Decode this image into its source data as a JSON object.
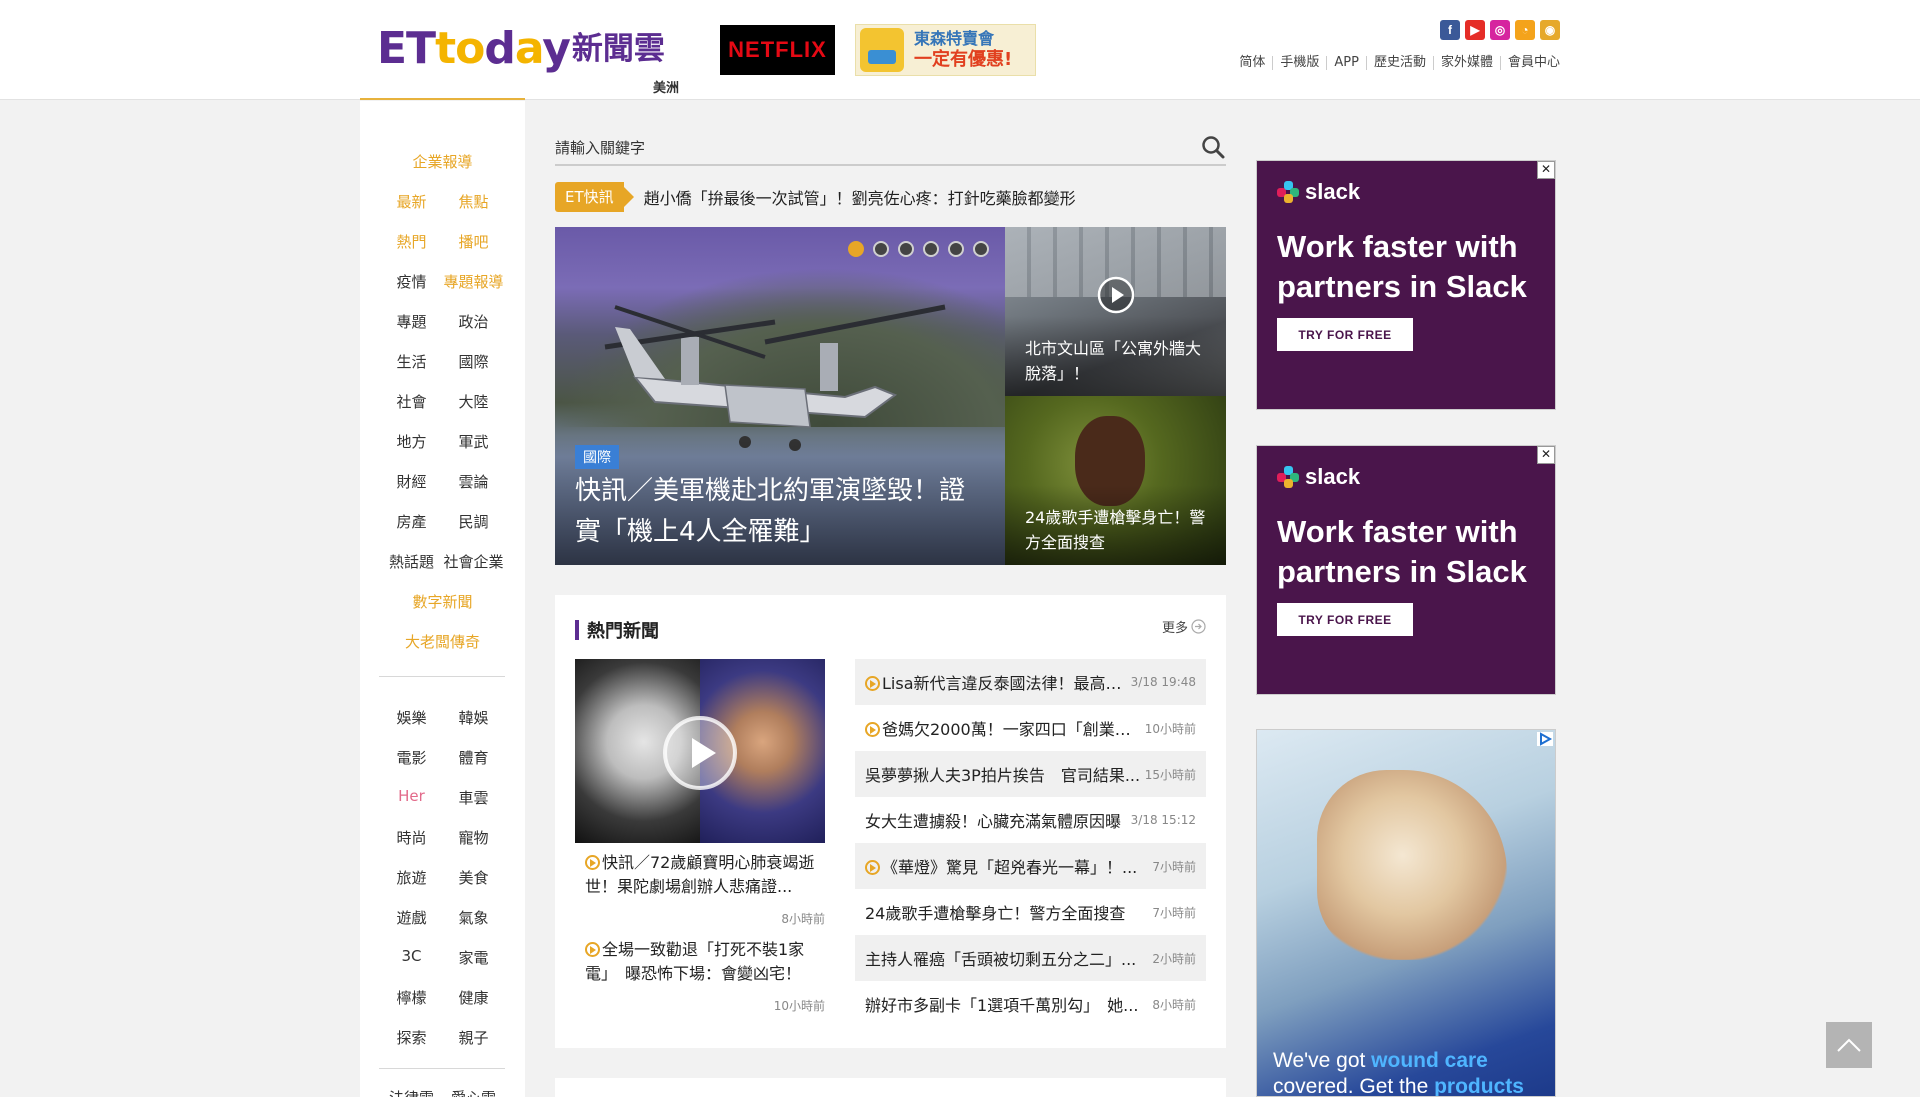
{
  "header": {
    "logo_et": "ETtoday",
    "logo_zh": "新聞雲",
    "region": "美洲",
    "netflix_label": "NETFLIX",
    "promo_line1": "東森特賣會",
    "promo_line2": "一定有優惠!",
    "social": [
      "facebook-icon",
      "youtube-icon",
      "instagram-icon",
      "rss-icon",
      "weibo-icon"
    ],
    "nav": [
      "简体",
      "手機版",
      "APP",
      "歷史活動",
      "家外媒體",
      "會員中心"
    ]
  },
  "sidebar": {
    "rows": [
      {
        "items": [
          {
            "label": "企業報導",
            "color": "gold"
          }
        ]
      },
      {
        "items": [
          {
            "label": "最新",
            "color": "gold"
          },
          {
            "label": "焦點",
            "color": "gold"
          }
        ]
      },
      {
        "items": [
          {
            "label": "熱門",
            "color": "gold"
          },
          {
            "label": "播吧",
            "color": "gold"
          }
        ]
      },
      {
        "items": [
          {
            "label": "疫情",
            "color": "dark"
          },
          {
            "label": "專題報導",
            "color": "gold"
          }
        ]
      },
      {
        "items": [
          {
            "label": "專題",
            "color": "dark"
          },
          {
            "label": "政治",
            "color": "dark"
          }
        ]
      },
      {
        "items": [
          {
            "label": "生活",
            "color": "dark"
          },
          {
            "label": "國際",
            "color": "dark"
          }
        ]
      },
      {
        "items": [
          {
            "label": "社會",
            "color": "dark"
          },
          {
            "label": "大陸",
            "color": "dark"
          }
        ]
      },
      {
        "items": [
          {
            "label": "地方",
            "color": "dark"
          },
          {
            "label": "軍武",
            "color": "dark"
          }
        ]
      },
      {
        "items": [
          {
            "label": "財經",
            "color": "dark"
          },
          {
            "label": "雲論",
            "color": "dark"
          }
        ]
      },
      {
        "items": [
          {
            "label": "房產",
            "color": "dark"
          },
          {
            "label": "民調",
            "color": "dark"
          }
        ]
      },
      {
        "items": [
          {
            "label": "熱話題",
            "color": "dark"
          },
          {
            "label": "社會企業",
            "color": "dark"
          }
        ]
      },
      {
        "items": [
          {
            "label": "數字新聞",
            "color": "gold"
          }
        ]
      },
      {
        "items": [
          {
            "label": "大老闆傳奇",
            "color": "gold"
          }
        ]
      },
      {
        "items": [
          {
            "label": "娛樂",
            "color": "dark"
          },
          {
            "label": "韓娛",
            "color": "dark"
          }
        ]
      },
      {
        "items": [
          {
            "label": "電影",
            "color": "dark"
          },
          {
            "label": "體育",
            "color": "dark"
          }
        ]
      },
      {
        "items": [
          {
            "label": "Her",
            "color": "pink"
          },
          {
            "label": "車雲",
            "color": "dark"
          }
        ]
      },
      {
        "items": [
          {
            "label": "時尚",
            "color": "dark"
          },
          {
            "label": "寵物",
            "color": "dark"
          }
        ]
      },
      {
        "items": [
          {
            "label": "旅遊",
            "color": "dark"
          },
          {
            "label": "美食",
            "color": "dark"
          }
        ]
      },
      {
        "items": [
          {
            "label": "遊戲",
            "color": "dark"
          },
          {
            "label": "氣象",
            "color": "dark"
          }
        ]
      },
      {
        "items": [
          {
            "label": "3C",
            "color": "dark"
          },
          {
            "label": "家電",
            "color": "dark"
          }
        ]
      },
      {
        "items": [
          {
            "label": "檸檬",
            "color": "dark"
          },
          {
            "label": "健康",
            "color": "dark"
          }
        ]
      },
      {
        "items": [
          {
            "label": "探索",
            "color": "dark"
          },
          {
            "label": "親子",
            "color": "dark"
          }
        ]
      },
      {
        "items": [
          {
            "label": "法律雲",
            "color": "dark"
          },
          {
            "label": "愛心雲",
            "color": "dark"
          }
        ]
      }
    ]
  },
  "search": {
    "placeholder": "請輸入關鍵字"
  },
  "flash": {
    "tag": "ET快訊",
    "text": "趙小僑「拚最後一次試管」！劉亮佐心疼：打針吃藥臉都變形"
  },
  "hero": {
    "tag": "國際",
    "title": "快訊／美軍機赴北約軍演墜毀！證實「機上4人全罹難」",
    "dots_total": 6,
    "active_dot": 1
  },
  "side_stories": [
    {
      "title": "北市文山區「公寓外牆大脫落」！",
      "video": true
    },
    {
      "title": "24歲歌手遭槍擊身亡！警方全面搜查",
      "video": false
    }
  ],
  "hot": {
    "title": "熱門新聞",
    "more": "更多",
    "left": [
      {
        "title": "快訊／72歲顧寶明心肺衰竭逝世！果陀劇場創辦人悲痛證...",
        "time": "8小時前"
      },
      {
        "title": "全場一致勸退「打死不裝1家電」　曝恐怖下場：會變凶宅！",
        "time": "10小時前"
      }
    ],
    "list": [
      {
        "title": "Lisa新代言違反泰國法律！最高「...",
        "time": "3/18 19:48",
        "video": true
      },
      {
        "title": "爸媽欠2000萬！一家四口「創業賣...",
        "time": "10小時前",
        "video": true
      },
      {
        "title": "吳夢夢揪人夫3P拍片挨告　官司結果...",
        "time": "15小時前",
        "video": false
      },
      {
        "title": "女大生遭擄殺！心臟充滿氣體原因曝",
        "time": "3/18 15:12",
        "video": false
      },
      {
        "title": "《華燈》驚見「超兇春光一幕」！...",
        "time": "7小時前",
        "video": true
      },
      {
        "title": "24歲歌手遭槍擊身亡！警方全面搜查",
        "time": "7小時前",
        "video": false
      },
      {
        "title": "主持人罹癌「舌頭被切剩五分之二」...",
        "time": "2小時前",
        "video": false
      },
      {
        "title": "辦好市多副卡「1選項千萬別勾」　她...",
        "time": "8小時前",
        "video": false
      }
    ]
  },
  "ads": {
    "slack_brand": "slack",
    "slack_headline": "Work faster with partners in Slack",
    "slack_cta": "TRY FOR FREE",
    "close": "✕",
    "medical_text_1": "We've got ",
    "medical_hl_1": "wound care",
    "medical_text_2": "covered. Get the ",
    "medical_hl_2": "products"
  },
  "colors": {
    "brand_purple": "#5c2d91",
    "accent_gold": "#e7a626",
    "slack_bg": "#4a154b"
  }
}
